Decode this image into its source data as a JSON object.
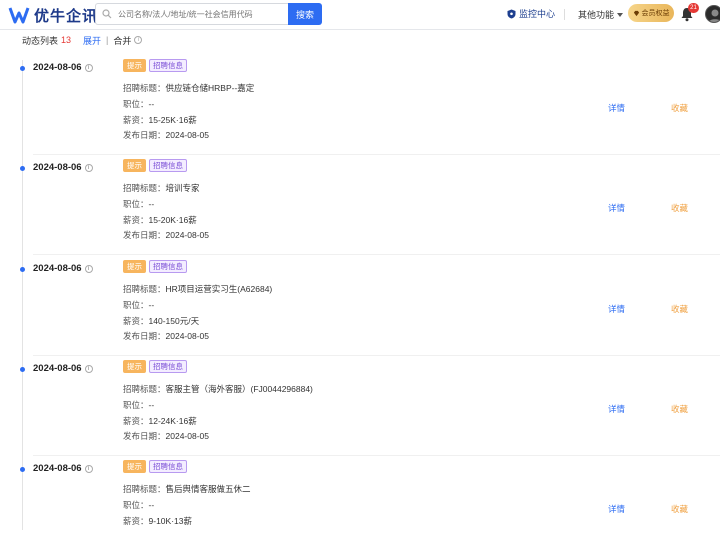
{
  "header": {
    "logo_text": "优牛企讯",
    "search_placeholder": "公司名称/法人/地址/统一社会信用代码",
    "search_button": "搜索",
    "monitor_label": "监控中心",
    "other_functions": "其他功能",
    "vip_label": "会员权益",
    "notification_count": "21"
  },
  "subbar": {
    "title": "动态列表",
    "count": "13",
    "expand": "展开",
    "separator": "|",
    "merge": "合并"
  },
  "labels": {
    "title_key": "招聘标题：",
    "position_key": "职位：",
    "salary_key": "薪资：",
    "date_key": "发布日期：",
    "detail": "详情",
    "collect": "收藏"
  },
  "entries": [
    {
      "date": "2024-08-06",
      "tag1": "提示",
      "tag2": "招聘信息",
      "title": "供应链仓储HRBP--嘉定",
      "position": "--",
      "salary": "15-25K·16薪",
      "publish_date": "2024-08-05"
    },
    {
      "date": "2024-08-06",
      "tag1": "提示",
      "tag2": "招聘信息",
      "title": "培训专家",
      "position": "--",
      "salary": "15-20K·16薪",
      "publish_date": "2024-08-05"
    },
    {
      "date": "2024-08-06",
      "tag1": "提示",
      "tag2": "招聘信息",
      "title": "HR项目运营实习生(A62684)",
      "position": "--",
      "salary": "140-150元/天",
      "publish_date": "2024-08-05"
    },
    {
      "date": "2024-08-06",
      "tag1": "提示",
      "tag2": "招聘信息",
      "title": "客服主管（海外客服）(FJ0044296884)",
      "position": "--",
      "salary": "12-24K·16薪",
      "publish_date": "2024-08-05"
    },
    {
      "date": "2024-08-06",
      "tag1": "提示",
      "tag2": "招聘信息",
      "title": "售后舆情客服做五休二",
      "position": "--",
      "salary": "9-10K·13薪",
      "publish_date": ""
    }
  ],
  "colors": {
    "accent": "#2d6cf2",
    "orange_tag": "#f7b55e",
    "purple_tag": "#7b4fd6",
    "collect": "#f0a040"
  }
}
